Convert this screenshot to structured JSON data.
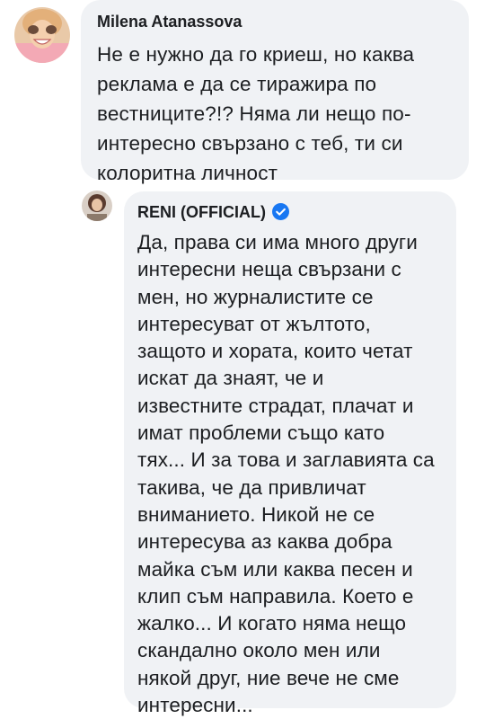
{
  "comments": [
    {
      "author": "Milena Atanassova",
      "avatar": "avatar-photo-smiling-woman",
      "text": "Не е нужно да го криеш, но каква\nреклама е да се тиражира по\nвестниците?!? Няма ли нещо по-\nинтересно свързано с теб, ти си\nколоритна личност"
    },
    {
      "author": "RENI (OFFICIAL)",
      "verified_icon": "verified-badge-icon",
      "avatar": "avatar-photo-woman",
      "text": "Да, права си има много други\nинтересни неща свързани с\nмен, но журналистите се\nинтересуват от жълтото,\nзащото и хората, които четат\nискат да знаят, че и\nизвестните страдат, плачат и\nимат проблеми също като\nтях... И за това и заглавията са\nтакива, че да привличат\nвниманието. Никой не се\nинтересува аз каква добра\nмайка съм или каква песен и\nклип съм  направила. Което е\nжалко... И когато няма нещо\nскандално около мен или\nнякой друг, ние вече не сме\nинтересни..."
    }
  ],
  "colors": {
    "bubble": "#f0f2f5",
    "text": "#1c1e21",
    "verified": "#1877f2"
  }
}
